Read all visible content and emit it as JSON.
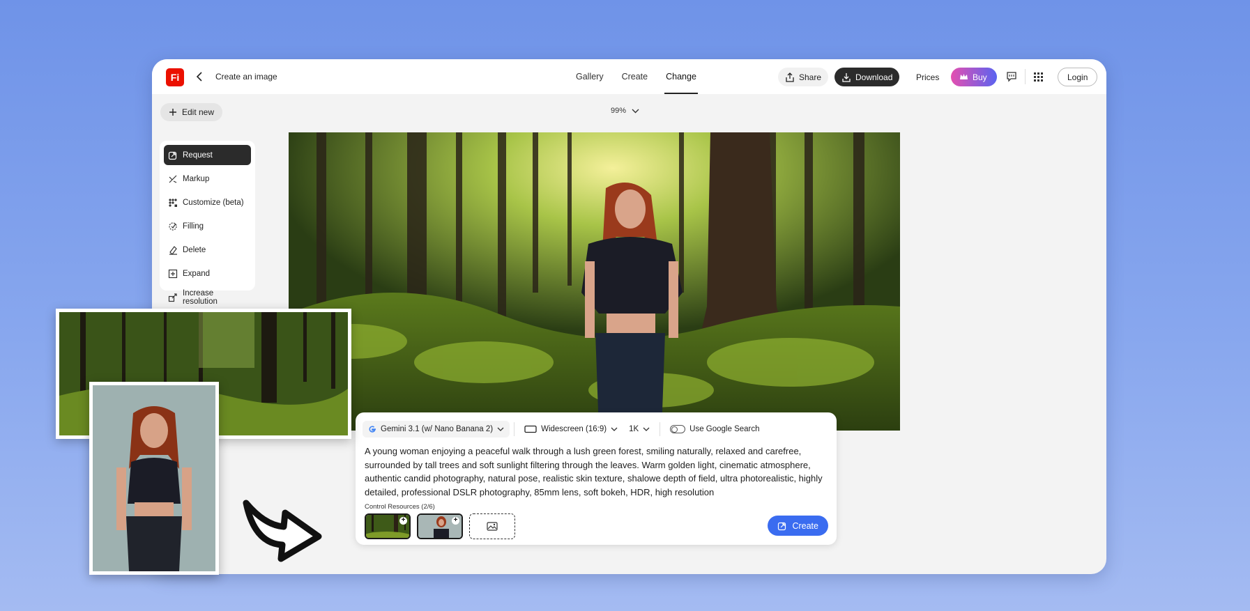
{
  "header": {
    "logo_text": "Fi",
    "title": "Create an image",
    "tabs": [
      {
        "label": "Gallery"
      },
      {
        "label": "Create"
      },
      {
        "label": "Change",
        "active": true
      }
    ],
    "share_label": "Share",
    "download_label": "Download",
    "prices_label": "Prices",
    "buy_label": "Buy",
    "login_label": "Login"
  },
  "toolbar": {
    "edit_new_label": "Edit new",
    "zoom": "99%"
  },
  "sidebar": {
    "items": [
      {
        "label": "Request",
        "icon": "request-icon",
        "active": true
      },
      {
        "label": "Markup",
        "icon": "markup-icon"
      },
      {
        "label": "Customize (beta)",
        "icon": "customize-icon"
      },
      {
        "label": "Filling",
        "icon": "filling-icon"
      },
      {
        "label": "Delete",
        "icon": "delete-icon"
      },
      {
        "label": "Expand",
        "icon": "expand-icon"
      },
      {
        "label": "Increase resolution",
        "icon": "upscale-icon"
      }
    ]
  },
  "prompt": {
    "model": "Gemini 3.1 (w/ Nano Banana 2)",
    "aspect": "Widescreen (16:9)",
    "resolution": "1K",
    "google_search_label": "Use Google Search",
    "google_search_enabled": false,
    "text": "A young woman enjoying a peaceful walk through a lush green forest, smiling naturally, relaxed and carefree, surrounded by tall trees and soft sunlight filtering through the leaves. Warm golden light, cinematic atmosphere, authentic candid photography, natural pose, realistic skin texture, shalowe depth of field, ultra photorealistic, highly detailed, professional DSLR photography, 85mm lens, soft bokeh, HDR, high resolution",
    "control_resources_label": "Control Resources (2/6)",
    "create_label": "Create"
  },
  "colors": {
    "background": "#7d9ce9",
    "accent": "#3a6cf0",
    "logo": "#eb1000"
  }
}
